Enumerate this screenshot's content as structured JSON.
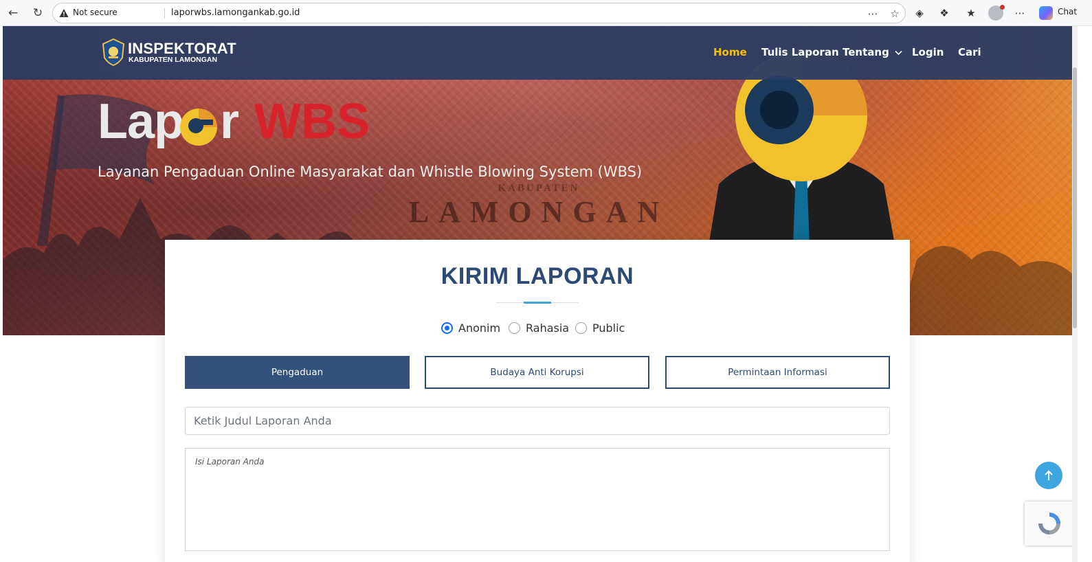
{
  "browser": {
    "security_label": "Not secure",
    "url": "laporwbs.lamongankab.go.id",
    "chat_label": "Chat"
  },
  "site": {
    "brand_title": "INSPEKTORAT",
    "brand_subtitle": "KABUPATEN LAMONGAN",
    "nav": [
      {
        "label": "Home",
        "active": true
      },
      {
        "label": "Tulis Laporan",
        "active": false
      },
      {
        "label": "Tentang",
        "has_dropdown": true
      },
      {
        "label": "Login"
      },
      {
        "label": "Cari"
      }
    ]
  },
  "hero": {
    "logo_part1": "Lap",
    "logo_part2": "r",
    "logo_part3": "WBS",
    "tagline": "Layanan Pengaduan Online Masyarakat dan Whistle Blowing System (WBS)",
    "banner_word_small": "KABUPATEN",
    "banner_word_large": "LAMONGAN"
  },
  "form": {
    "title": "KIRIM LAPORAN",
    "privacy_options": [
      {
        "label": "Anonim",
        "checked": true
      },
      {
        "label": "Rahasia",
        "checked": false
      },
      {
        "label": "Public",
        "checked": false
      }
    ],
    "categories": [
      {
        "label": "Pengaduan",
        "active": true
      },
      {
        "label": "Budaya Anti Korupsi",
        "active": false
      },
      {
        "label": "Permintaan Informasi",
        "active": false
      }
    ],
    "title_placeholder": "Ketik Judul Laporan Anda",
    "body_placeholder": "Isi Laporan Anda"
  },
  "colors": {
    "navbar": "#2a3c63",
    "primary": "#2d4a76",
    "active_nav": "#f6c000",
    "accent": "#3fa5e0",
    "wbs_red": "#d8222a"
  }
}
